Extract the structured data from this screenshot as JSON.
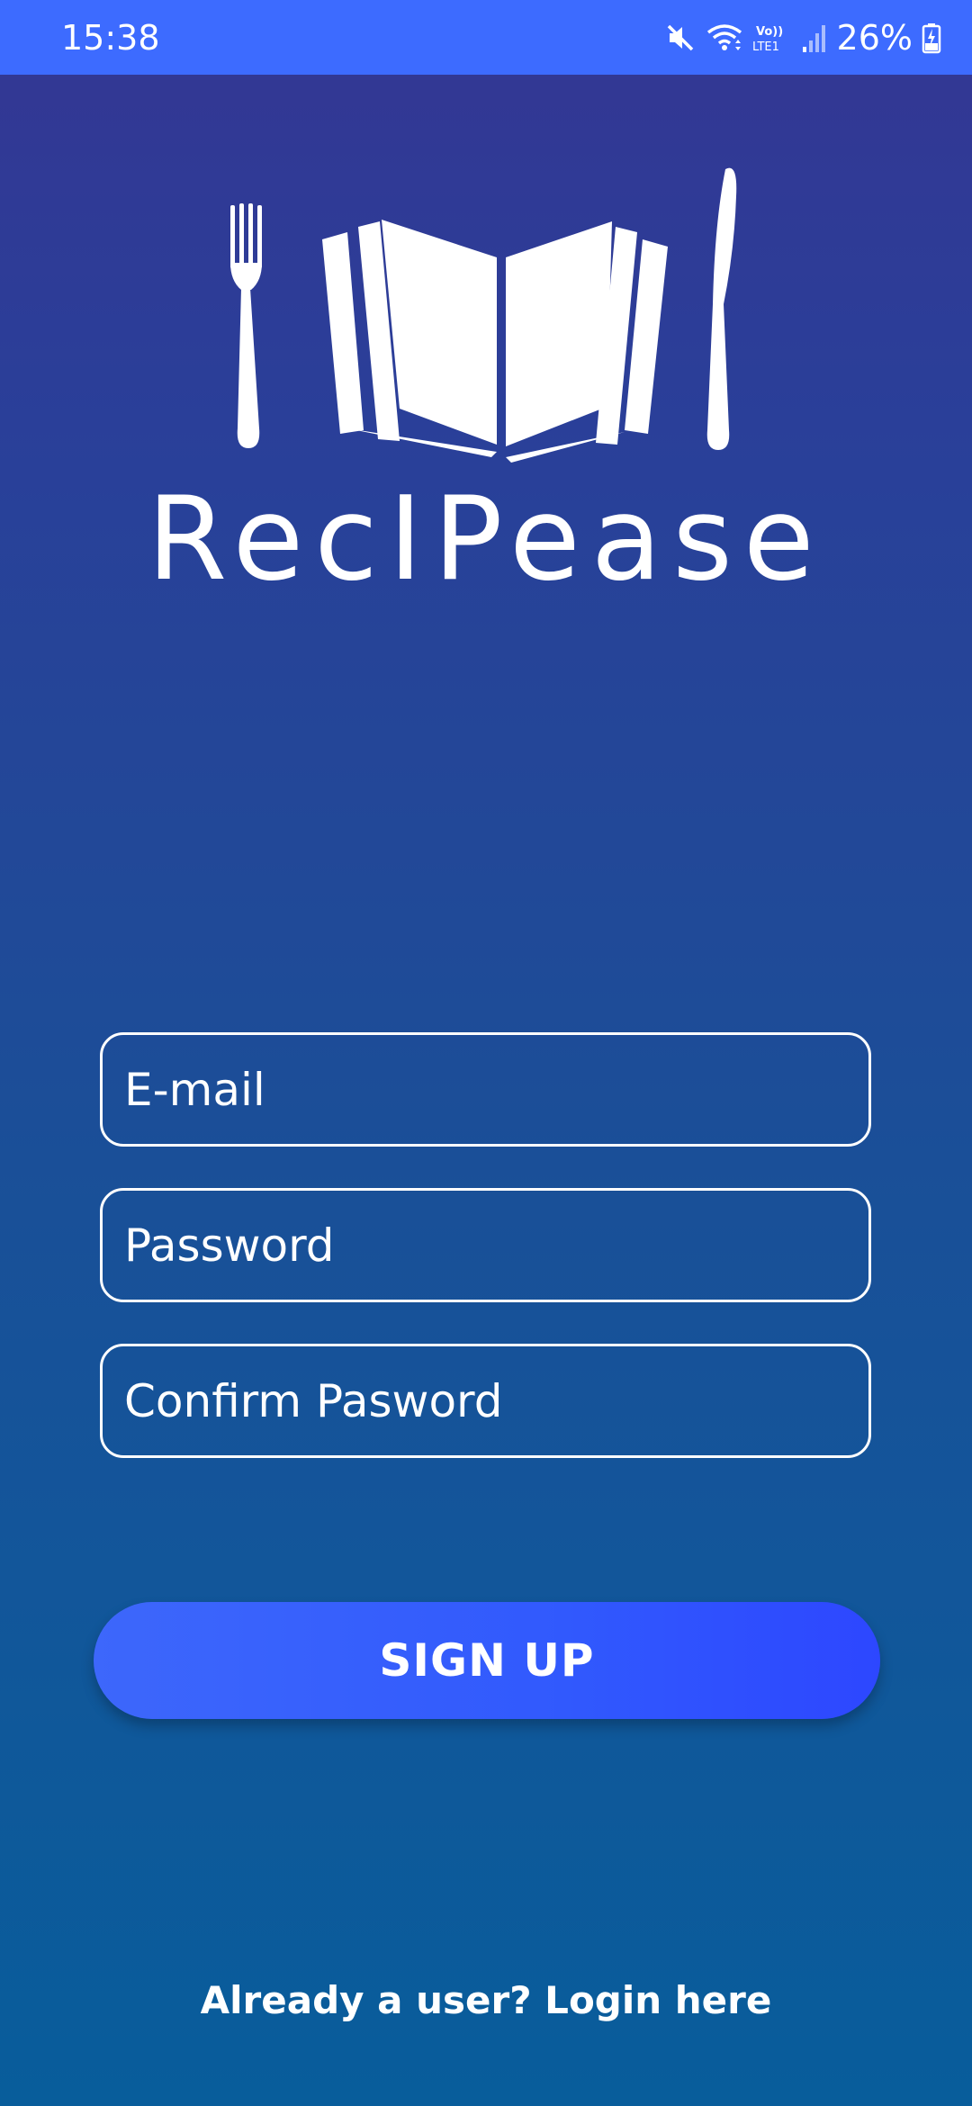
{
  "status_bar": {
    "time": "15:38",
    "battery_percent": "26%",
    "network_label": "Vo)) LTE1",
    "icons": [
      "mute-icon",
      "wifi-icon",
      "volte-icon",
      "signal-icon",
      "battery-charging-icon"
    ],
    "background_color": "#3d6bff"
  },
  "app": {
    "name": "RecipEase",
    "logo_icon": "recipe-book-fork-knife-icon",
    "wordmark": "RecIPease"
  },
  "form": {
    "email": {
      "placeholder": "E-mail",
      "value": ""
    },
    "password": {
      "placeholder": "Password",
      "value": ""
    },
    "confirm_password": {
      "placeholder": "Confirm Pasword",
      "value": ""
    },
    "signup_label": "SIGN UP",
    "signup_color": "#3159fd"
  },
  "footer": {
    "login_prompt": "Already a user? Login here"
  },
  "colors": {
    "background_top": "#343693",
    "background_bottom": "#085d9b",
    "text": "#ffffff"
  }
}
